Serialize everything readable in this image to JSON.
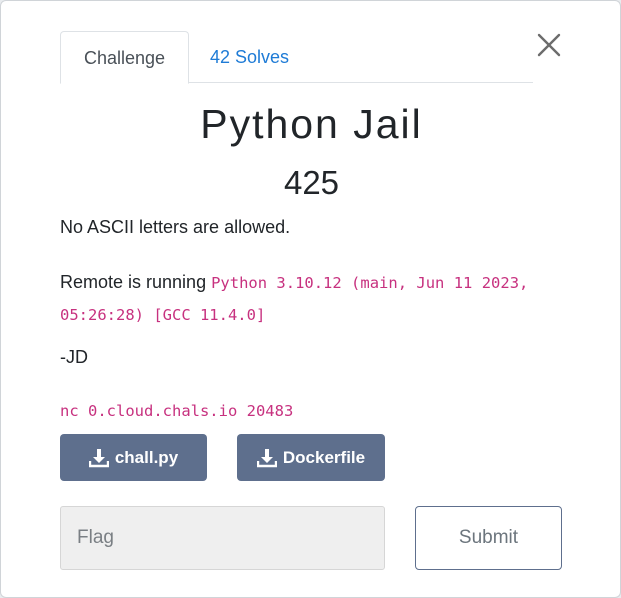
{
  "modal": {
    "close_icon": "close-icon",
    "tabs": [
      {
        "label": "Challenge",
        "active": true
      },
      {
        "label": "42 Solves",
        "active": false
      }
    ],
    "title": "Python Jail",
    "points": "425",
    "description": {
      "line1": "No ASCII letters are allowed.",
      "line2_prefix": "Remote is running ",
      "line2_code": "Python 3.10.12 (main, Jun 11 2023, 05:26:28) [GCC 11.4.0]",
      "line3": "-JD",
      "connection_code": "nc 0.cloud.chals.io 20483"
    },
    "files": [
      {
        "label": "chall.py",
        "icon": "download-icon"
      },
      {
        "label": "Dockerfile",
        "icon": "download-icon"
      }
    ],
    "flag_input": {
      "placeholder": "Flag",
      "value": ""
    },
    "submit_label": "Submit"
  },
  "colors": {
    "accent_link": "#1e7bd6",
    "button_bg": "#5e6f8d",
    "code_pink": "#c7317f"
  }
}
